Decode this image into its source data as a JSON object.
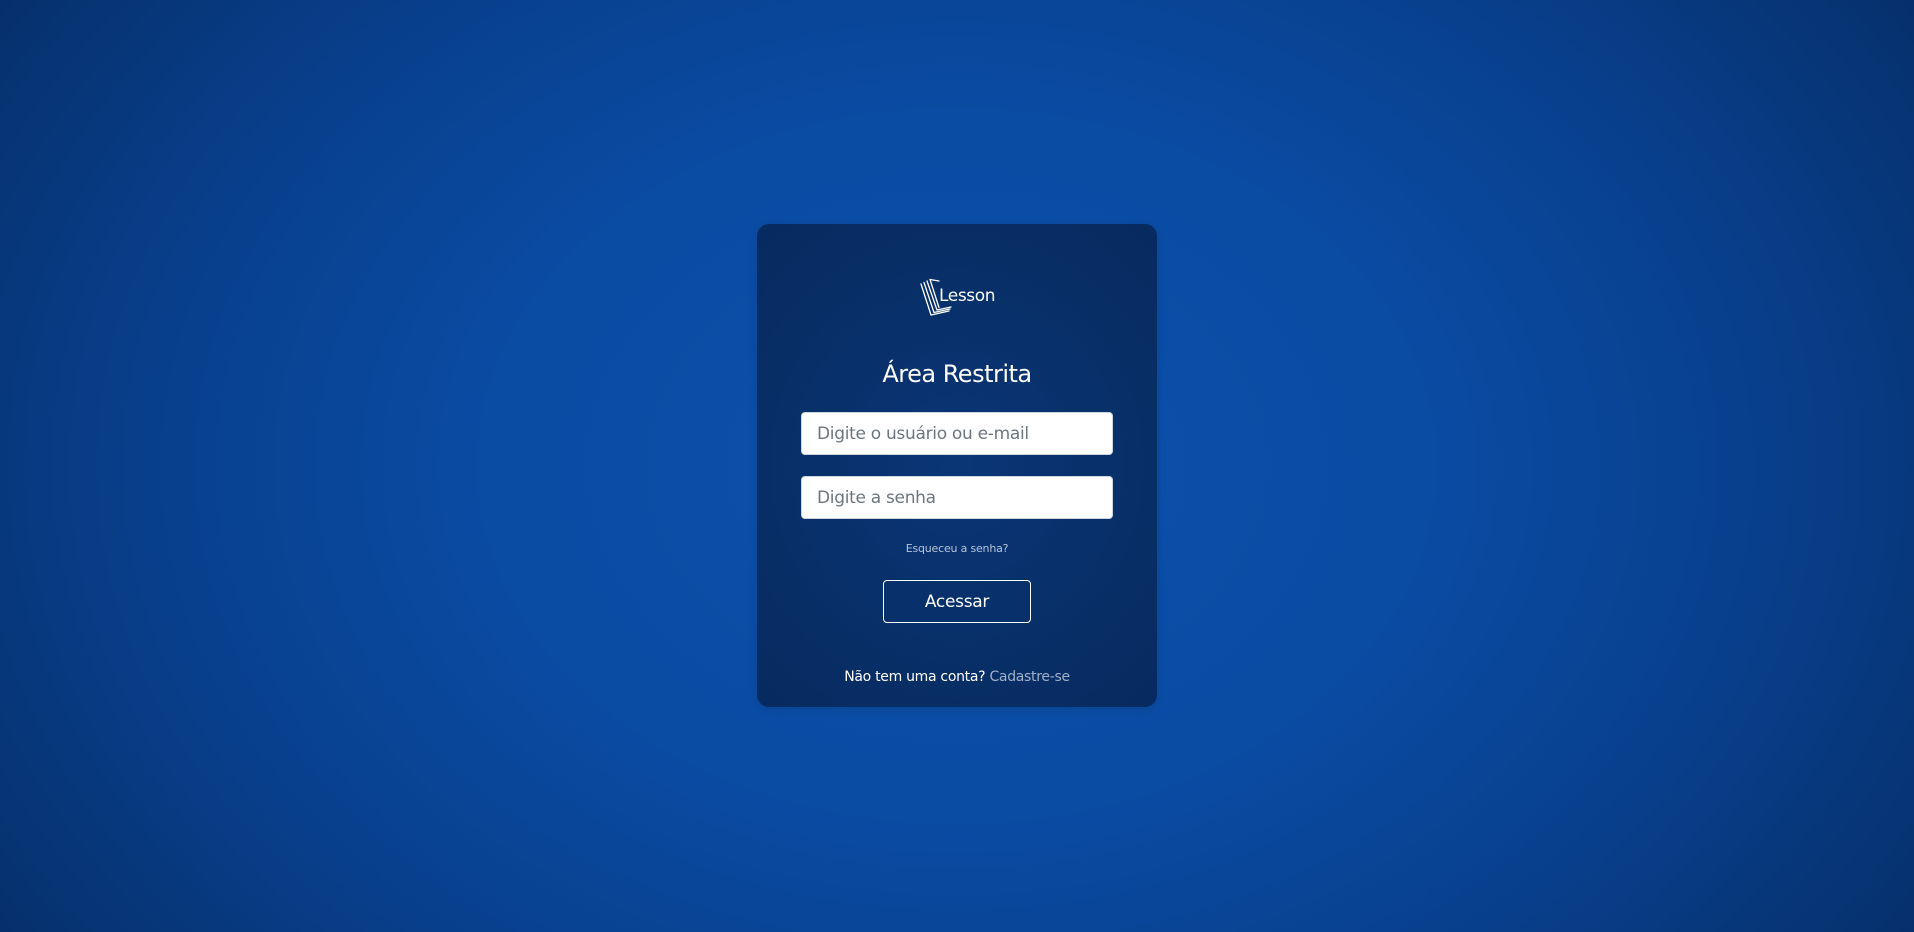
{
  "brand": {
    "logo_text": "Lesson",
    "logo_icon": "stacked-pages-icon"
  },
  "login": {
    "title": "Área Restrita",
    "username_placeholder": "Digite o usuário ou e-mail",
    "password_placeholder": "Digite a senha",
    "forgot_link": "Esqueceu a senha?",
    "submit_label": "Acessar",
    "signup_prompt": "Não tem uma conta?",
    "signup_link": "Cadastre-se"
  },
  "colors": {
    "background": "#0a4ba3",
    "card": "#082f68",
    "link": "#9fb0c9",
    "text": "#ffffff"
  }
}
